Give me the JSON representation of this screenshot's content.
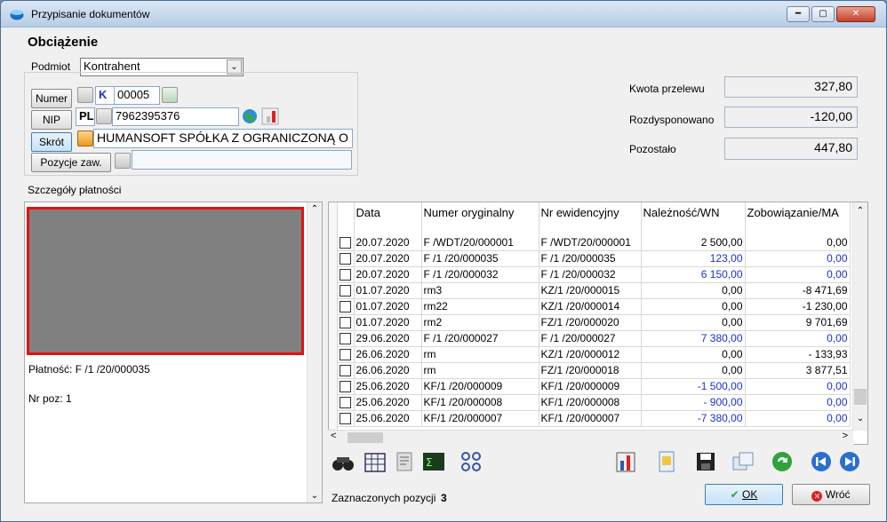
{
  "window": {
    "title": "Przypisanie dokumentów"
  },
  "form": {
    "heading": "Obciążenie",
    "podmiot_label": "Podmiot",
    "podmiot_value": "Kontrahent",
    "numer_button": "Numer",
    "numer_type": "K",
    "numer_value": "00005",
    "nip_button": "NIP",
    "nip_prefix": "PL",
    "nip_value": "7962395376",
    "skrot_button": "Skrót",
    "skrot_value": "HUMANSOFT SPÓŁKA Z OGRANICZONĄ O",
    "pozycje_button": "Pozycje zaw.",
    "pozycje_value": ""
  },
  "amounts": {
    "kwota_label": "Kwota przelewu",
    "kwota_value": "327,80",
    "rozdysp_label": "Rozdysponowano",
    "rozdysp_value": "-120,00",
    "pozostalo_label": "Pozostało",
    "pozostalo_value": "447,80"
  },
  "details": {
    "section_label": "Szczegóły płatności",
    "platnosc_text": "Płatność: F /1  /20/000035",
    "nrpoz_text": "Nr poz: 1"
  },
  "grid": {
    "headers": [
      "Data",
      "Numer oryginalny",
      "Nr ewidencyjny",
      "Należność/WN",
      "Zobowiązanie/MA"
    ],
    "rows": [
      {
        "date": "20.07.2020",
        "orig": "F /WDT/20/000001",
        "ewid": "F /WDT/20/000001",
        "wn": "2 500,00",
        "ma": "0,00",
        "wn_blue": false,
        "ma_blue": false
      },
      {
        "date": "20.07.2020",
        "orig": "F /1  /20/000035",
        "ewid": "F /1  /20/000035",
        "wn": "123,00",
        "ma": "0,00",
        "wn_blue": true,
        "ma_blue": true
      },
      {
        "date": "20.07.2020",
        "orig": "F /1  /20/000032",
        "ewid": "F /1  /20/000032",
        "wn": "6 150,00",
        "ma": "0,00",
        "wn_blue": true,
        "ma_blue": true
      },
      {
        "date": "01.07.2020",
        "orig": "rm3",
        "ewid": "KZ/1  /20/000015",
        "wn": "0,00",
        "ma": "-8 471,69",
        "wn_blue": false,
        "ma_blue": false
      },
      {
        "date": "01.07.2020",
        "orig": "rm22",
        "ewid": "KZ/1  /20/000014",
        "wn": "0,00",
        "ma": "-1 230,00",
        "wn_blue": false,
        "ma_blue": false
      },
      {
        "date": "01.07.2020",
        "orig": "rm2",
        "ewid": "FZ/1  /20/000020",
        "wn": "0,00",
        "ma": "9 701,69",
        "wn_blue": false,
        "ma_blue": false
      },
      {
        "date": "29.06.2020",
        "orig": "F /1  /20/000027",
        "ewid": "F /1  /20/000027",
        "wn": "7 380,00",
        "ma": "0,00",
        "wn_blue": true,
        "ma_blue": true
      },
      {
        "date": "26.06.2020",
        "orig": "rm",
        "ewid": "KZ/1  /20/000012",
        "wn": "0,00",
        "ma": "- 133,93",
        "wn_blue": false,
        "ma_blue": false
      },
      {
        "date": "26.06.2020",
        "orig": "rm",
        "ewid": "FZ/1  /20/000018",
        "wn": "0,00",
        "ma": "3 877,51",
        "wn_blue": false,
        "ma_blue": false
      },
      {
        "date": "25.06.2020",
        "orig": "KF/1  /20/000009",
        "ewid": "KF/1  /20/000009",
        "wn": "-1 500,00",
        "ma": "0,00",
        "wn_blue": true,
        "ma_blue": true
      },
      {
        "date": "25.06.2020",
        "orig": "KF/1  /20/000008",
        "ewid": "KF/1  /20/000008",
        "wn": "- 900,00",
        "ma": "0,00",
        "wn_blue": true,
        "ma_blue": true
      },
      {
        "date": "25.06.2020",
        "orig": "KF/1  /20/000007",
        "ewid": "KF/1  /20/000007",
        "wn": "-7 380,00",
        "ma": "0,00",
        "wn_blue": true,
        "ma_blue": true
      }
    ]
  },
  "footer": {
    "selected_label": "Zaznaczonych pozycji",
    "selected_count": "3",
    "ok_label": "OK",
    "exit_label": "Wróć"
  }
}
